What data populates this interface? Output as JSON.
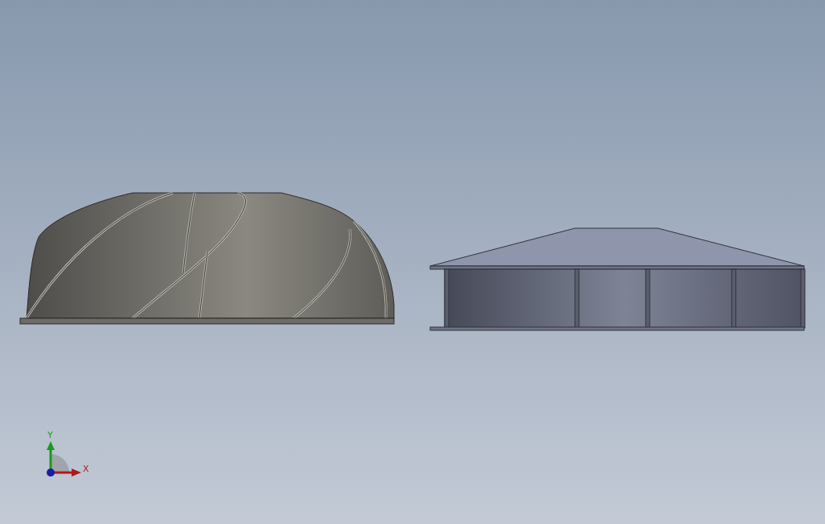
{
  "viewport": {
    "models": [
      {
        "kind": "impeller"
      },
      {
        "kind": "housing"
      }
    ]
  },
  "triad": {
    "y_label": "Y",
    "x_label": "X"
  }
}
